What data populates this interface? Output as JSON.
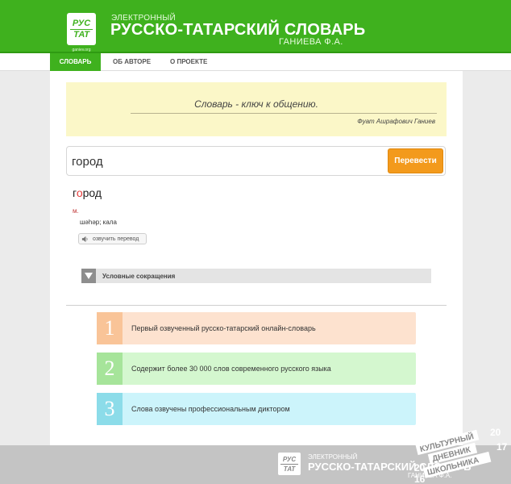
{
  "header": {
    "logo_top": "РУС",
    "logo_bottom": "ТАТ",
    "logo_site": "ganiev.org",
    "small_title": "ЭЛЕКТРОННЫЙ",
    "title": "РУССКО-ТАТАРСКИЙ СЛОВАРЬ",
    "author": "ГАНИЕВА Ф.А."
  },
  "nav": {
    "items": [
      {
        "label": "СЛОВАРЬ",
        "active": true
      },
      {
        "label": "ОБ АВТОРЕ",
        "active": false
      },
      {
        "label": "О ПРОЕКТЕ",
        "active": false
      }
    ]
  },
  "quote": {
    "text": "Словарь - ключ к общению.",
    "author": "Фуат Ашрафович Ганиев"
  },
  "search": {
    "value": "город",
    "button_label": "Перевести"
  },
  "result": {
    "word_before": "г",
    "word_stress": "о",
    "word_after": "род",
    "part_of_speech": "м.",
    "translation": "шәһәр; кала",
    "speak_label": "озвучить перевод"
  },
  "abbreviations": {
    "label": "Условные сокращения"
  },
  "features": [
    {
      "number": "1",
      "text": "Первый озвученный русско-татарский онлайн-словарь"
    },
    {
      "number": "2",
      "text": "Содержит более 30 000 слов современного русского языка"
    },
    {
      "number": "3",
      "text": "Слова озвучены профессиональным диктором"
    }
  ],
  "footer": {
    "logo_top": "РУС",
    "logo_bottom": "ТАТ",
    "logo_site": "ganiev.org",
    "small_title": "ЭЛЕКТРОННЫЙ",
    "title": "РУССКО-ТАТАРСКИЙ СЛОВАРЬ",
    "author": "ГАНИЕВА Ф.А."
  },
  "badge": {
    "line1": "КУЛЬТУРНЫЙ",
    "line2": "ДНЕВНИК",
    "line3": "ШКОЛЬНИКА",
    "year_top": "20",
    "year_top2": "17",
    "year_bottom": "20",
    "year_bottom2": "16"
  },
  "colors": {
    "brand_green": "#3fb11e",
    "button_orange": "#f39a1c",
    "quote_bg": "#fbf7c8"
  }
}
